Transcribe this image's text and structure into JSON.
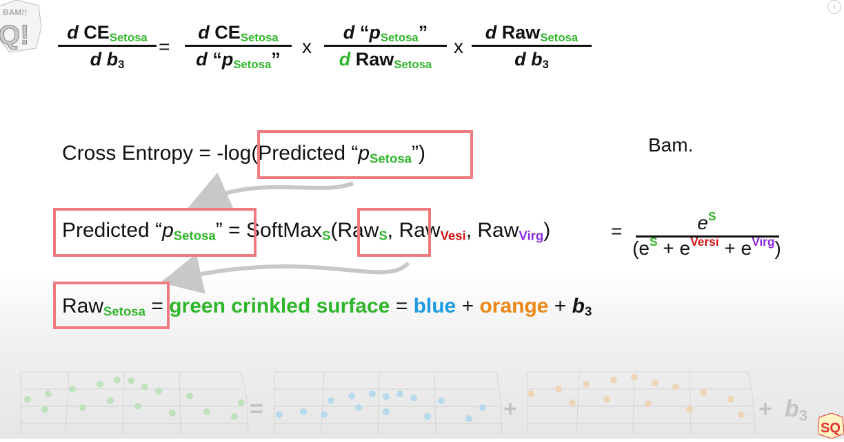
{
  "equation": {
    "lhs_num_d": "d",
    "lhs_num_ce": "CE",
    "lhs_num_sub": "Setosa",
    "lhs_den_d": "d",
    "lhs_den_b": "b",
    "lhs_den_sub": "3",
    "equals": "=",
    "t1_num_d": "d",
    "t1_num_ce": "CE",
    "t1_num_sub": "Setosa",
    "t1_den_d": "d",
    "t1_den_q1": "“",
    "t1_den_p": "p",
    "t1_den_sub": "Setosa",
    "t1_den_q2": "”",
    "times1": "x",
    "t2_num_d": "d",
    "t2_num_q1": "“",
    "t2_num_p": "p",
    "t2_num_sub": "Setosa",
    "t2_num_q2": "”",
    "t2_den_d": "d",
    "t2_den_raw": "Raw",
    "t2_den_sub": "Setosa",
    "times2": "x",
    "t3_num_d": "d",
    "t3_num_raw": "Raw",
    "t3_num_sub": "Setosa",
    "t3_den_d": "d",
    "t3_den_b": "b",
    "t3_den_sub": "3"
  },
  "cross_entropy": {
    "prefix": "Cross Entropy = -log(Predicted “",
    "p": "p",
    "sub": "Setosa",
    "suffix": "”)"
  },
  "bam_label": "Bam.",
  "softmax_line": {
    "prefix": "Predicted “",
    "p": "p",
    "p_sub": "Setosa",
    "mid": "” = SoftMax",
    "softmax_sub": "S",
    "open": "(Raw",
    "raw_s_sub": "S",
    "comma1": ", Raw",
    "vesi_sub": "Vesi",
    "comma2": ", Raw",
    "virg_sub": "Virg",
    "close": ")",
    "equals": "=",
    "num_e": "e",
    "num_sup": "S",
    "den_open": "(e",
    "den_sup1": "S",
    "den_plus1": " + e",
    "den_sup2": "Versi",
    "den_plus2": " + e",
    "den_sup3": "Virg",
    "den_close": ")"
  },
  "raw_line": {
    "raw": "Raw",
    "raw_sub": "Setosa",
    "eq1": " = ",
    "green_text": "green crinkled surface",
    "eq2": " = ",
    "blue_text": "blue",
    "plus1": " + ",
    "orange_text": "orange",
    "plus2": " + ",
    "b": "b",
    "b_sub": "3"
  },
  "bottom": {
    "equals": "=",
    "plus1": "+",
    "plus2": "+",
    "b": "b",
    "b_sub": "3"
  },
  "logos": {
    "top_left": "BAM!! Q!",
    "bottom_right": "SQ!"
  },
  "colors": {
    "setosa_green": "#2fb52a",
    "versi_red": "#d01515",
    "virg_purple": "#8a2be2",
    "blue": "#1e9be0",
    "orange": "#ea8716",
    "box": "#ef7b80",
    "arrow": "#c8c8c8"
  }
}
